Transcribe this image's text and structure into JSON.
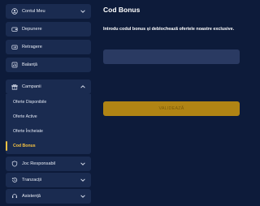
{
  "sidebar": {
    "items": [
      {
        "label": "Contul Meu",
        "icon": "user-icon",
        "chevron": "down"
      },
      {
        "label": "Depunere",
        "icon": "wallet-icon"
      },
      {
        "label": "Retragere",
        "icon": "withdraw-icon"
      },
      {
        "label": "Balanță",
        "icon": "balance-icon"
      },
      {
        "label": "Campanii",
        "icon": "gift-icon",
        "chevron": "up"
      }
    ],
    "submenu": [
      {
        "label": "Oferte Disponibile"
      },
      {
        "label": "Oferte Active"
      },
      {
        "label": "Oferte Încheiate"
      },
      {
        "label": "Cod Bonus",
        "active": true
      }
    ],
    "bottom_items": [
      {
        "label": "Joc Responsabil",
        "icon": "shield-icon",
        "chevron": "down"
      },
      {
        "label": "Tranzacții",
        "icon": "history-icon",
        "chevron": "down"
      },
      {
        "label": "Asistență",
        "icon": "support-icon",
        "chevron": "down"
      }
    ]
  },
  "main": {
    "title": "Cod Bonus",
    "description": "Introdu codul bonus și deblochează ofertele noastre exclusive.",
    "input": {
      "value": "",
      "placeholder": ""
    },
    "validate_label": "VALIDEAZĂ"
  },
  "colors": {
    "background": "#0d1b3a",
    "panel": "#1a2b50",
    "input": "#2a3a62",
    "accent": "#f5c242",
    "button": "#b08414"
  }
}
